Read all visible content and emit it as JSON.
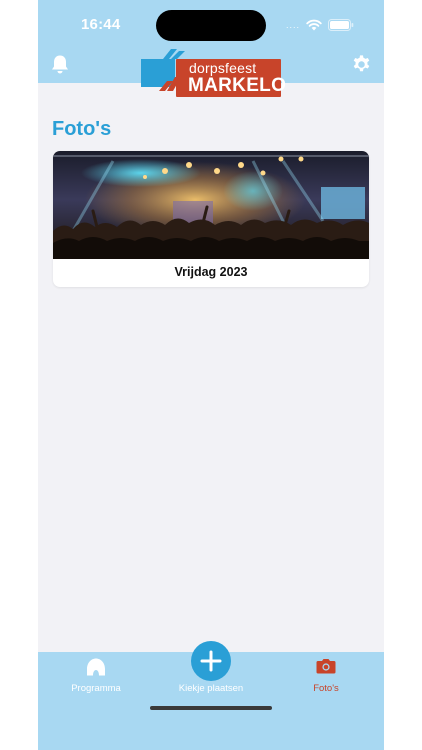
{
  "status_bar": {
    "time": "16:44",
    "signal_dots": "....",
    "icons": [
      "wifi-icon",
      "battery-icon"
    ]
  },
  "header": {
    "logo": {
      "small": "dorpsfeest",
      "big": "MARKELO"
    },
    "left_icon": "bell-icon",
    "right_icon": "gear-icon"
  },
  "page": {
    "title": "Foto's"
  },
  "cards": [
    {
      "label": "Vrijdag 2023",
      "image": "concert-crowd-photo"
    }
  ],
  "tabbar": {
    "tabs": [
      {
        "label": "Programma",
        "icon": "tent-icon",
        "active": false
      },
      {
        "label": "Kiekje plaatsen",
        "icon": "plus-icon",
        "active": false
      },
      {
        "label": "Foto's",
        "icon": "camera-icon",
        "active": true
      }
    ]
  },
  "colors": {
    "header": "#a8d8f2",
    "accent": "#2a9fd6",
    "brand_red": "#c8442a",
    "background": "#f2f2f6"
  }
}
